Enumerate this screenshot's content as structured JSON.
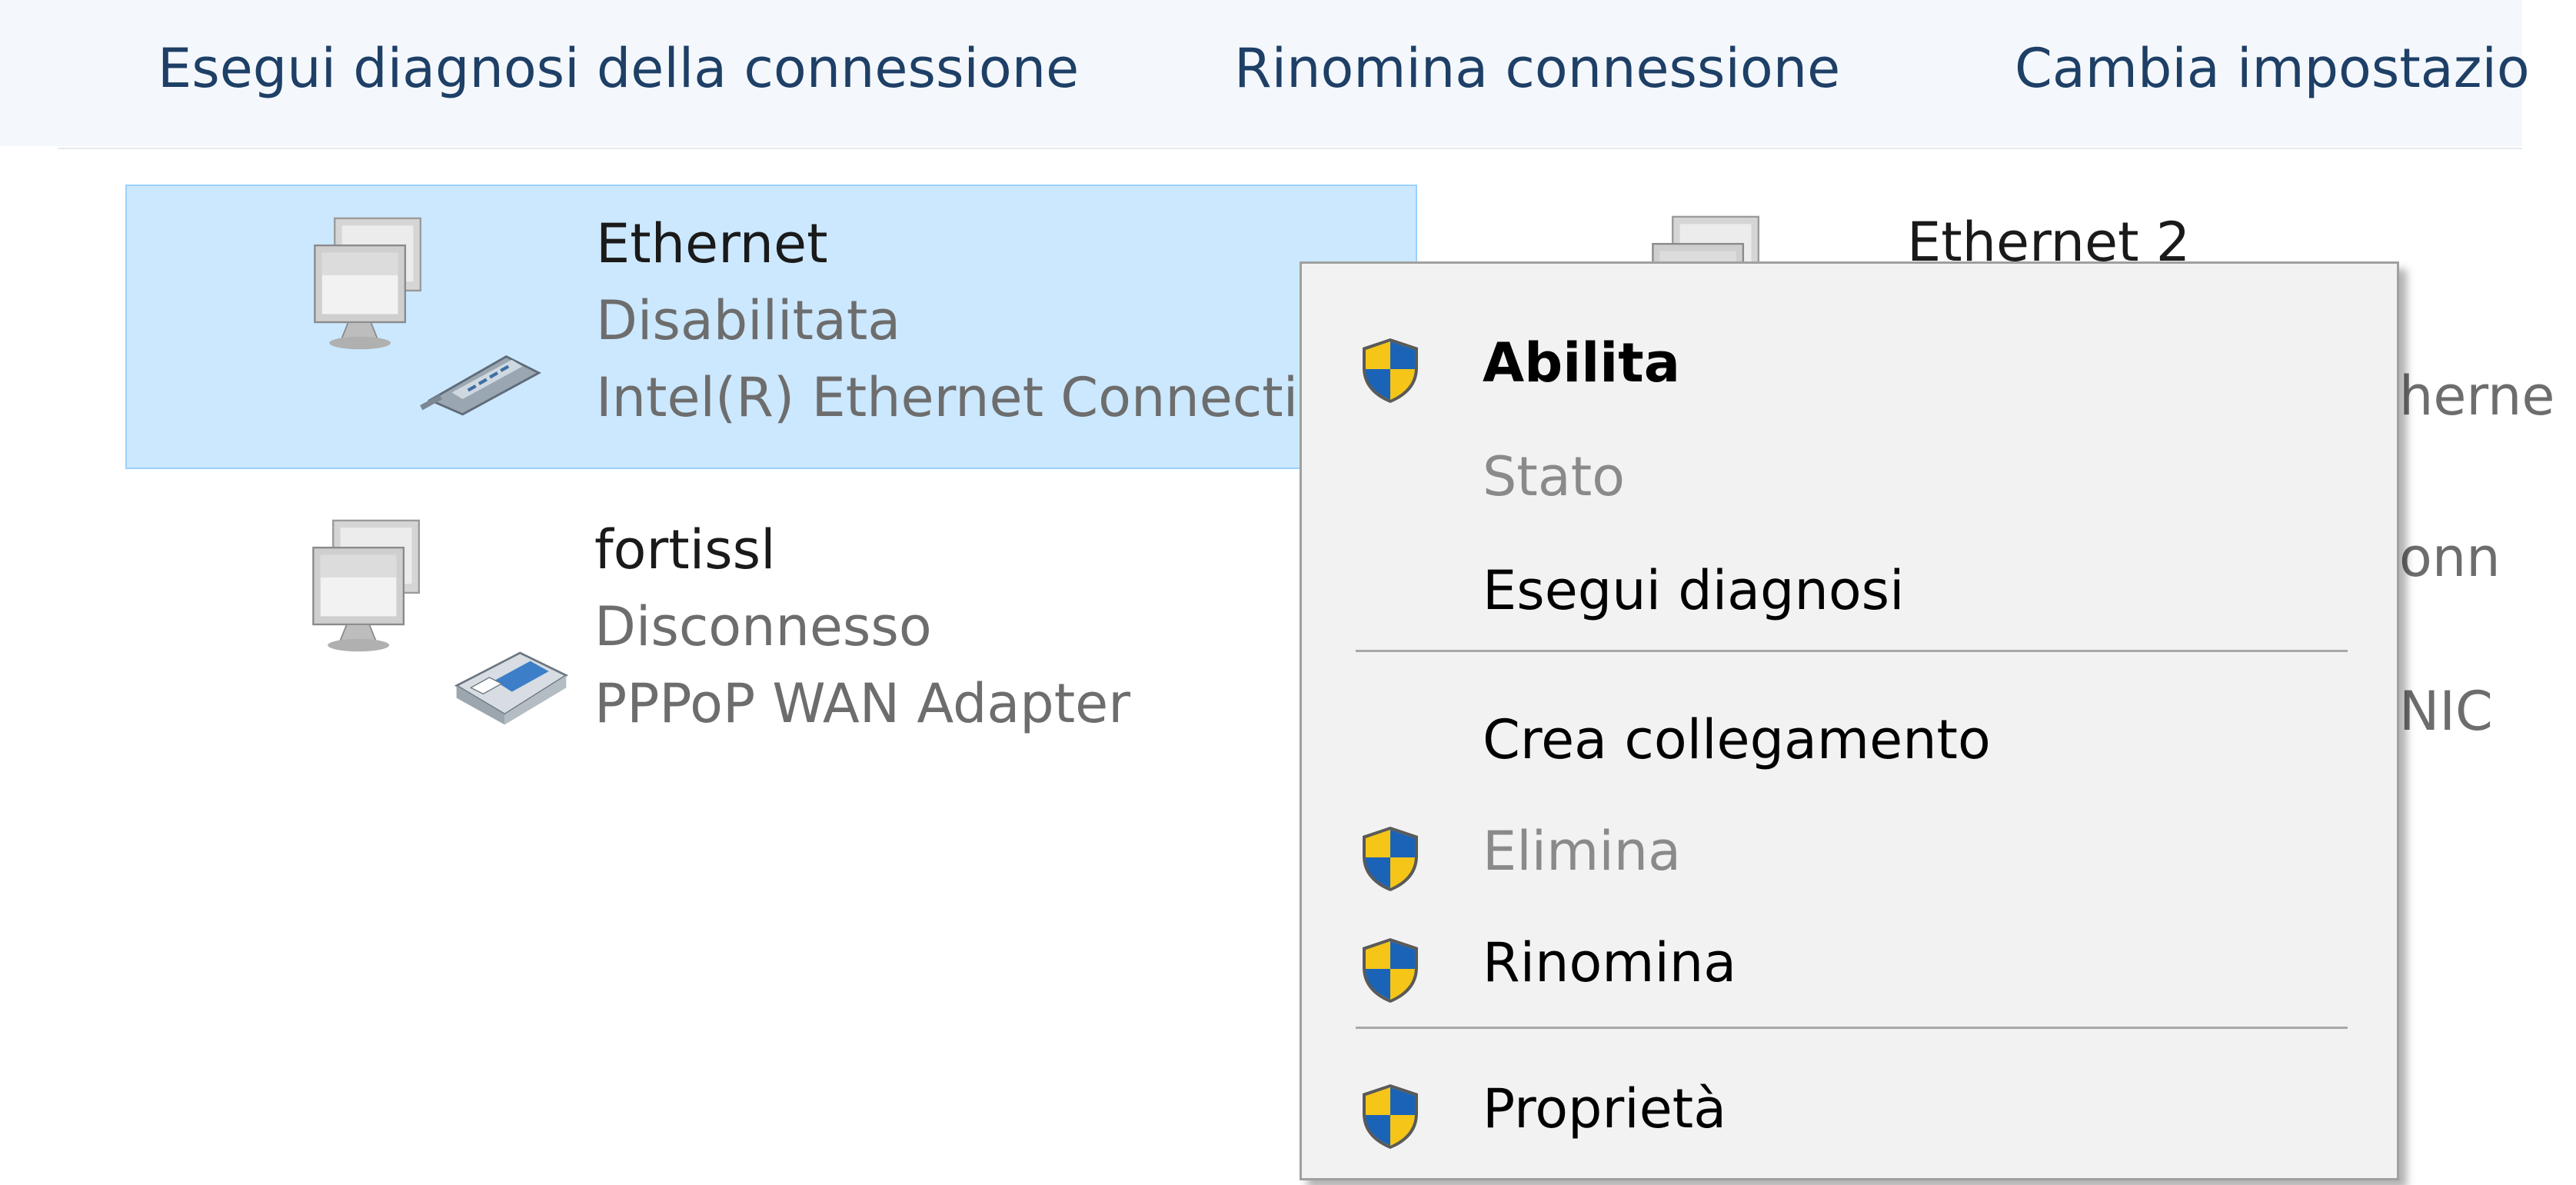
{
  "toolbar": {
    "items": [
      {
        "label": "Esegui diagnosi della connessione"
      },
      {
        "label": "Rinomina connessione"
      },
      {
        "label": "Cambia impostazio"
      }
    ]
  },
  "connections": [
    {
      "name": "Ethernet",
      "status": "Disabilitata",
      "device": "Intel(R) Ethernet Connecti",
      "selected": true
    },
    {
      "name": "fortissl",
      "status": "Disconnesso",
      "device": "PPPoP WAN Adapter",
      "selected": false
    },
    {
      "name": "Ethernet 2",
      "status": "",
      "device": "herne",
      "selected": false
    }
  ],
  "partial_right": {
    "line1": "onn",
    "line2": "NIC"
  },
  "context_menu": {
    "items": [
      {
        "label": "Abilita",
        "shield": true,
        "bold": true,
        "disabled": false
      },
      {
        "label": "Stato",
        "shield": false,
        "bold": false,
        "disabled": true
      },
      {
        "label": "Esegui diagnosi",
        "shield": false,
        "bold": false,
        "disabled": false
      },
      {
        "label": "Crea collegamento",
        "shield": false,
        "bold": false,
        "disabled": false
      },
      {
        "label": "Elimina",
        "shield": true,
        "bold": false,
        "disabled": true
      },
      {
        "label": "Rinomina",
        "shield": true,
        "bold": false,
        "disabled": false
      },
      {
        "label": "Proprietà",
        "shield": true,
        "bold": false,
        "disabled": false
      }
    ]
  },
  "colors": {
    "toolbar_bg": "#f4f8fc",
    "toolbar_text": "#1e3f66",
    "selection_bg": "#cce8ff",
    "selection_border": "#99d1ff",
    "shield_blue": "#1b63b6",
    "shield_yellow": "#f5c518"
  },
  "icons": {
    "network_adapter": "network-adapter-icon",
    "ethernet_cable": "ethernet-plug-icon",
    "modem": "dialup-modem-icon",
    "uac_shield": "uac-shield-icon"
  }
}
